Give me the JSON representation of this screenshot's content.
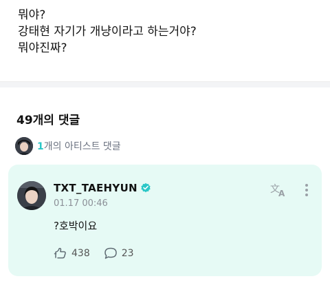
{
  "post": {
    "lines": [
      "뭐야?",
      "강태현 자기가 개냥이라고 하는거야?",
      "뭐야진짜?"
    ]
  },
  "comments": {
    "count_label": "49개의 댓글",
    "artist_count": "1",
    "artist_label": "개의 아티스트 댓글"
  },
  "comment": {
    "author": "TXT_TAEHYUN",
    "timestamp": "01.17 00:46",
    "text": "?호박이요",
    "likes": "438",
    "replies": "23"
  },
  "icons": {
    "verified": "verified-badge-icon",
    "translate": "translate-icon",
    "more": "more-vertical-icon",
    "like": "like-icon",
    "reply": "reply-icon"
  },
  "colors": {
    "accent": "#2bc7c7",
    "card_bg": "#e6faf5",
    "muted": "#8b8f97"
  }
}
